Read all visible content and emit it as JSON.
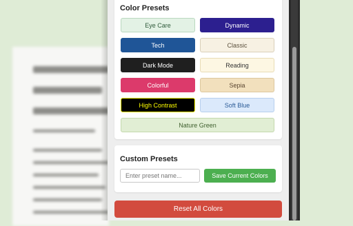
{
  "color_presets": {
    "title": "Color Presets",
    "items": [
      {
        "label": "Eye Care",
        "bg": "#e3f2e5",
        "fg": "#2e5a3a",
        "border": "#b9d8bf"
      },
      {
        "label": "Dynamic",
        "bg": "#2c1f8f",
        "fg": "#ffffff",
        "border": "#2c1f8f"
      },
      {
        "label": "Tech",
        "bg": "#1f5597",
        "fg": "#ffffff",
        "border": "#1f5597"
      },
      {
        "label": "Classic",
        "bg": "#f7f1e3",
        "fg": "#5a4f3c",
        "border": "#d9cfb9"
      },
      {
        "label": "Dark Mode",
        "bg": "#1f1f1f",
        "fg": "#ffffff",
        "border": "#1f1f1f"
      },
      {
        "label": "Reading",
        "bg": "#fdf7e3",
        "fg": "#333333",
        "border": "#e8dcb5"
      },
      {
        "label": "Colorful",
        "bg": "#dc3a6b",
        "fg": "#ffffff",
        "border": "#dc3a6b"
      },
      {
        "label": "Sepia",
        "bg": "#f2e0bd",
        "fg": "#5a4530",
        "border": "#dcc79e"
      },
      {
        "label": "High Contrast",
        "bg": "#000000",
        "fg": "#ffff00",
        "border": "#ffff00"
      },
      {
        "label": "Soft Blue",
        "bg": "#dbe9fb",
        "fg": "#2a5a96",
        "border": "#b7cfee"
      },
      {
        "label": "Nature Green",
        "bg": "#e1eed4",
        "fg": "#3f5f2e",
        "border": "#c3d8ad"
      }
    ]
  },
  "custom_presets": {
    "title": "Custom Presets",
    "input_placeholder": "Enter preset name...",
    "save_label": "Save Current Colors"
  },
  "reset_label": "Reset All Colors",
  "colors": {
    "background": "#dfecd6",
    "save_button": "#4caf50",
    "reset_button": "#d24b3e"
  }
}
